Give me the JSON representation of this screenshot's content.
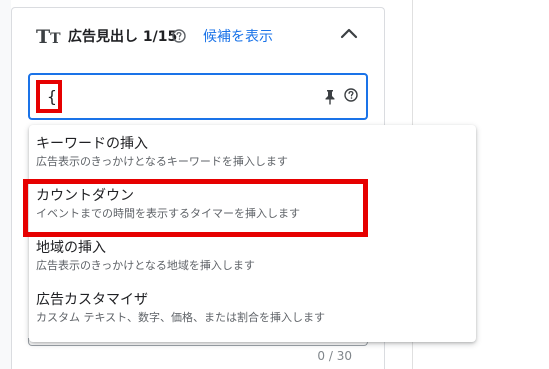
{
  "header": {
    "icon_label": "TT",
    "title": "広告見出し 1/15",
    "suggest_link": "候補を表示"
  },
  "headline_input": {
    "value": "{",
    "counter": "0 / 30"
  },
  "insert_menu": {
    "items": [
      {
        "title": "キーワードの挿入",
        "description": "広告表示のきっかけとなるキーワードを挿入します"
      },
      {
        "title": "カウントダウン",
        "description": "イベントまでの時間を表示するタイマーを挿入します"
      },
      {
        "title": "地域の挿入",
        "description": "広告表示のきっかけとなる地域を挿入します"
      },
      {
        "title": "広告カスタマイザ",
        "description": "カスタム テキスト、数字、価格、または割合を挿入します"
      }
    ]
  },
  "colors": {
    "accent": "#1a73e8",
    "highlight": "#e60000"
  }
}
